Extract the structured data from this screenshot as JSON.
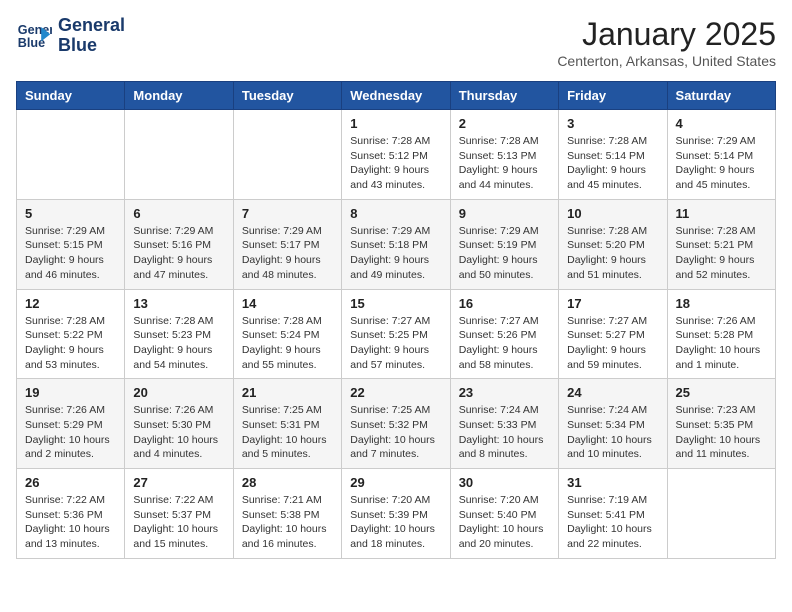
{
  "header": {
    "logo_line1": "General",
    "logo_line2": "Blue",
    "title": "January 2025",
    "subtitle": "Centerton, Arkansas, United States"
  },
  "days_of_week": [
    "Sunday",
    "Monday",
    "Tuesday",
    "Wednesday",
    "Thursday",
    "Friday",
    "Saturday"
  ],
  "weeks": [
    [
      {
        "day": "",
        "info": ""
      },
      {
        "day": "",
        "info": ""
      },
      {
        "day": "",
        "info": ""
      },
      {
        "day": "1",
        "info": "Sunrise: 7:28 AM\nSunset: 5:12 PM\nDaylight: 9 hours and 43 minutes."
      },
      {
        "day": "2",
        "info": "Sunrise: 7:28 AM\nSunset: 5:13 PM\nDaylight: 9 hours and 44 minutes."
      },
      {
        "day": "3",
        "info": "Sunrise: 7:28 AM\nSunset: 5:14 PM\nDaylight: 9 hours and 45 minutes."
      },
      {
        "day": "4",
        "info": "Sunrise: 7:29 AM\nSunset: 5:14 PM\nDaylight: 9 hours and 45 minutes."
      }
    ],
    [
      {
        "day": "5",
        "info": "Sunrise: 7:29 AM\nSunset: 5:15 PM\nDaylight: 9 hours and 46 minutes."
      },
      {
        "day": "6",
        "info": "Sunrise: 7:29 AM\nSunset: 5:16 PM\nDaylight: 9 hours and 47 minutes."
      },
      {
        "day": "7",
        "info": "Sunrise: 7:29 AM\nSunset: 5:17 PM\nDaylight: 9 hours and 48 minutes."
      },
      {
        "day": "8",
        "info": "Sunrise: 7:29 AM\nSunset: 5:18 PM\nDaylight: 9 hours and 49 minutes."
      },
      {
        "day": "9",
        "info": "Sunrise: 7:29 AM\nSunset: 5:19 PM\nDaylight: 9 hours and 50 minutes."
      },
      {
        "day": "10",
        "info": "Sunrise: 7:28 AM\nSunset: 5:20 PM\nDaylight: 9 hours and 51 minutes."
      },
      {
        "day": "11",
        "info": "Sunrise: 7:28 AM\nSunset: 5:21 PM\nDaylight: 9 hours and 52 minutes."
      }
    ],
    [
      {
        "day": "12",
        "info": "Sunrise: 7:28 AM\nSunset: 5:22 PM\nDaylight: 9 hours and 53 minutes."
      },
      {
        "day": "13",
        "info": "Sunrise: 7:28 AM\nSunset: 5:23 PM\nDaylight: 9 hours and 54 minutes."
      },
      {
        "day": "14",
        "info": "Sunrise: 7:28 AM\nSunset: 5:24 PM\nDaylight: 9 hours and 55 minutes."
      },
      {
        "day": "15",
        "info": "Sunrise: 7:27 AM\nSunset: 5:25 PM\nDaylight: 9 hours and 57 minutes."
      },
      {
        "day": "16",
        "info": "Sunrise: 7:27 AM\nSunset: 5:26 PM\nDaylight: 9 hours and 58 minutes."
      },
      {
        "day": "17",
        "info": "Sunrise: 7:27 AM\nSunset: 5:27 PM\nDaylight: 9 hours and 59 minutes."
      },
      {
        "day": "18",
        "info": "Sunrise: 7:26 AM\nSunset: 5:28 PM\nDaylight: 10 hours and 1 minute."
      }
    ],
    [
      {
        "day": "19",
        "info": "Sunrise: 7:26 AM\nSunset: 5:29 PM\nDaylight: 10 hours and 2 minutes."
      },
      {
        "day": "20",
        "info": "Sunrise: 7:26 AM\nSunset: 5:30 PM\nDaylight: 10 hours and 4 minutes."
      },
      {
        "day": "21",
        "info": "Sunrise: 7:25 AM\nSunset: 5:31 PM\nDaylight: 10 hours and 5 minutes."
      },
      {
        "day": "22",
        "info": "Sunrise: 7:25 AM\nSunset: 5:32 PM\nDaylight: 10 hours and 7 minutes."
      },
      {
        "day": "23",
        "info": "Sunrise: 7:24 AM\nSunset: 5:33 PM\nDaylight: 10 hours and 8 minutes."
      },
      {
        "day": "24",
        "info": "Sunrise: 7:24 AM\nSunset: 5:34 PM\nDaylight: 10 hours and 10 minutes."
      },
      {
        "day": "25",
        "info": "Sunrise: 7:23 AM\nSunset: 5:35 PM\nDaylight: 10 hours and 11 minutes."
      }
    ],
    [
      {
        "day": "26",
        "info": "Sunrise: 7:22 AM\nSunset: 5:36 PM\nDaylight: 10 hours and 13 minutes."
      },
      {
        "day": "27",
        "info": "Sunrise: 7:22 AM\nSunset: 5:37 PM\nDaylight: 10 hours and 15 minutes."
      },
      {
        "day": "28",
        "info": "Sunrise: 7:21 AM\nSunset: 5:38 PM\nDaylight: 10 hours and 16 minutes."
      },
      {
        "day": "29",
        "info": "Sunrise: 7:20 AM\nSunset: 5:39 PM\nDaylight: 10 hours and 18 minutes."
      },
      {
        "day": "30",
        "info": "Sunrise: 7:20 AM\nSunset: 5:40 PM\nDaylight: 10 hours and 20 minutes."
      },
      {
        "day": "31",
        "info": "Sunrise: 7:19 AM\nSunset: 5:41 PM\nDaylight: 10 hours and 22 minutes."
      },
      {
        "day": "",
        "info": ""
      }
    ]
  ]
}
